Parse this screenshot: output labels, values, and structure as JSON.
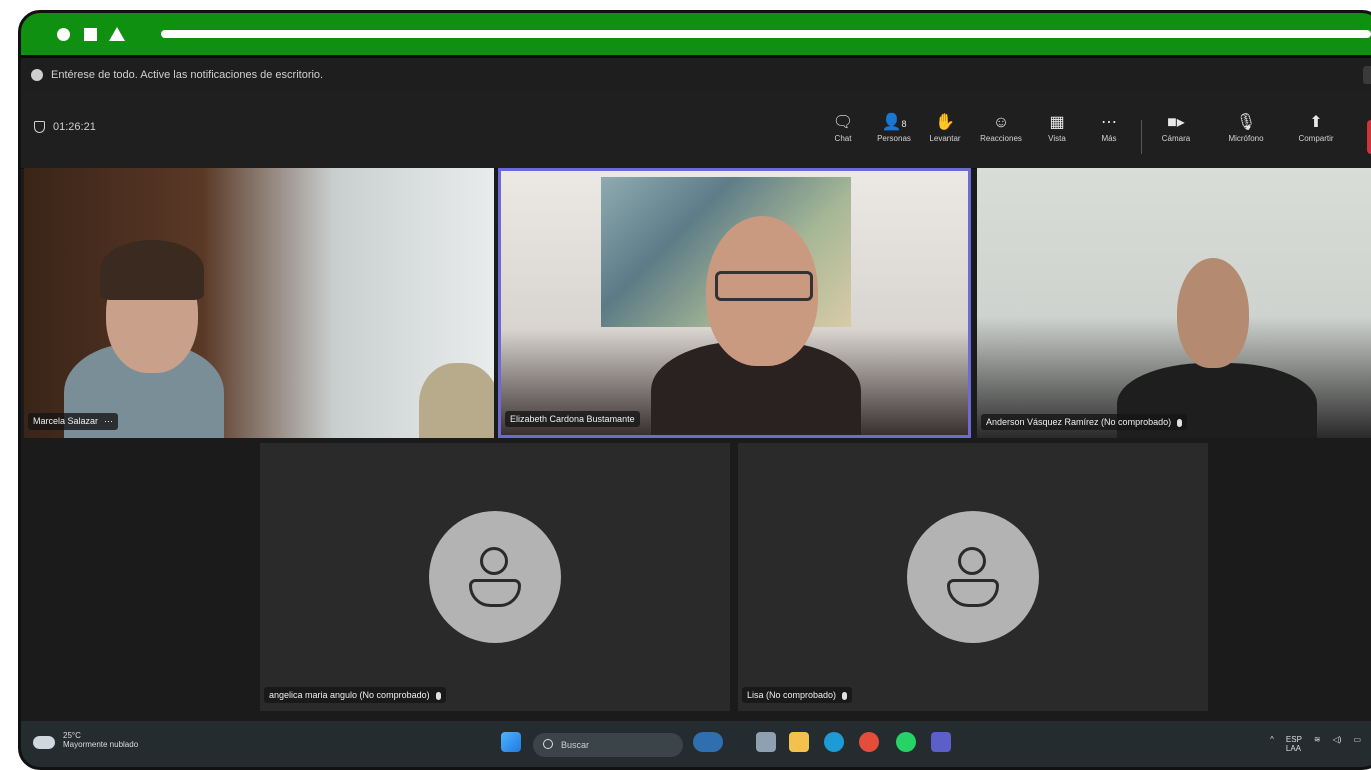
{
  "notification": {
    "text": "Entérese de todo. Active las notificaciones de escritorio."
  },
  "meeting": {
    "timer": "01:26:21"
  },
  "toolbar": {
    "items": [
      {
        "label": "Chat",
        "icon": "chat-icon"
      },
      {
        "label": "Personas",
        "icon": "people-icon",
        "count": "8"
      },
      {
        "label": "Levantar",
        "icon": "raise-hand-icon"
      },
      {
        "label": "Reacciones",
        "icon": "reactions-icon"
      },
      {
        "label": "Vista",
        "icon": "view-icon"
      },
      {
        "label": "Más",
        "icon": "more-icon"
      },
      {
        "label": "Cámara",
        "icon": "camera-icon"
      },
      {
        "label": "Micrófono",
        "icon": "microphone-icon"
      },
      {
        "label": "Compartir",
        "icon": "share-icon"
      }
    ]
  },
  "participants": [
    {
      "name": "Marcela Salazar",
      "has_more": true
    },
    {
      "name": "Elizabeth Cardona Bustamante",
      "active_speaker": true
    },
    {
      "name": "Anderson Vásquez Ramírez (No comprobado)",
      "muted": true
    },
    {
      "name": "angelica maria angulo (No comprobado)",
      "muted": true
    },
    {
      "name": "Lisa (No comprobado)",
      "muted": true
    }
  ],
  "taskbar": {
    "weather_temp": "25°C",
    "weather_desc": "Mayormente nublado",
    "search_placeholder": "Buscar",
    "language": "ESP",
    "language_sub": "LAA"
  }
}
